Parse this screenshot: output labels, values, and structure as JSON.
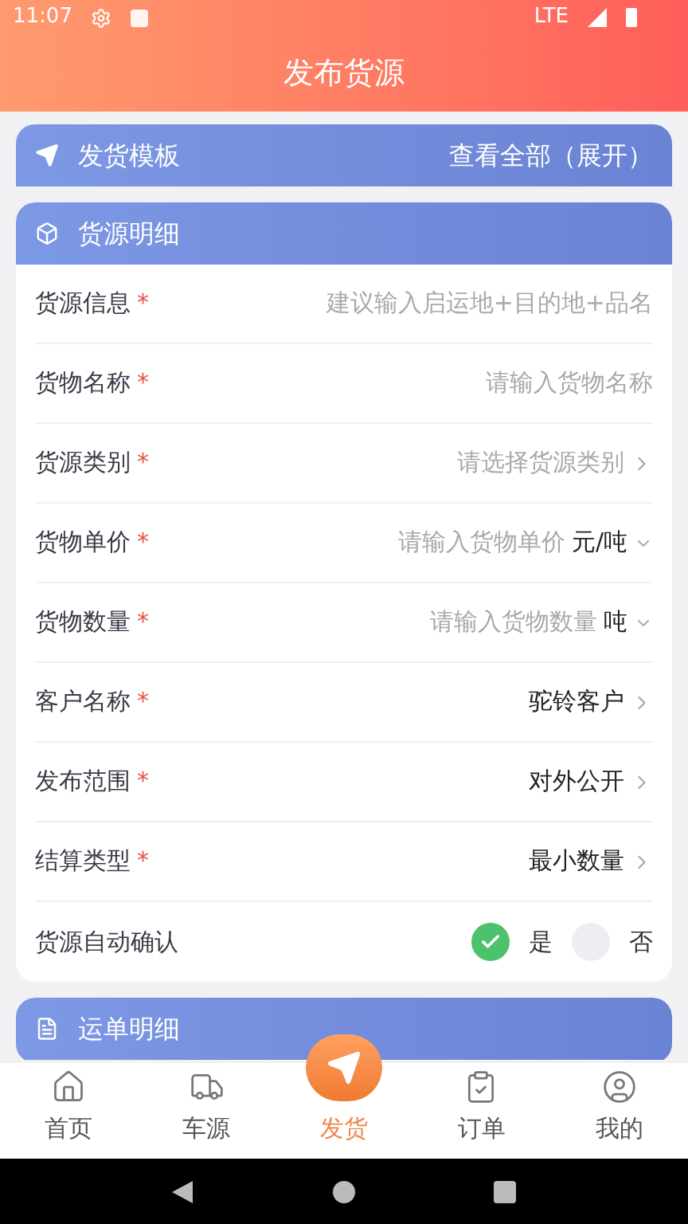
{
  "status_bar": {
    "time": "11:07",
    "network": "LTE"
  },
  "header": {
    "title": "发布货源"
  },
  "template_bar": {
    "title": "发货模板",
    "link": "查看全部（展开）"
  },
  "cargo_section": {
    "title": "货源明细",
    "rows": [
      {
        "label": "货源信息",
        "required_mark": "*",
        "kind": "input",
        "placeholder": "建议输入启运地+目的地+品名"
      },
      {
        "label": "货物名称",
        "required_mark": "*",
        "kind": "input",
        "placeholder": "请输入货物名称"
      },
      {
        "label": "货源类别",
        "required_mark": "*",
        "kind": "select",
        "placeholder": "请选择货源类别"
      },
      {
        "label": "货物单价",
        "required_mark": "*",
        "kind": "unit",
        "placeholder": "请输入货物单价",
        "unit": "元/吨"
      },
      {
        "label": "货物数量",
        "required_mark": "*",
        "kind": "unit",
        "placeholder": "请输入货物数量",
        "unit": "吨"
      },
      {
        "label": "客户名称",
        "required_mark": "*",
        "kind": "select",
        "value": "驼铃客户"
      },
      {
        "label": "发布范围",
        "required_mark": "*",
        "kind": "select",
        "value": "对外公开"
      },
      {
        "label": "结算类型",
        "required_mark": "*",
        "kind": "select",
        "value": "最小数量"
      },
      {
        "label": "货源自动确认",
        "kind": "radio",
        "options": [
          {
            "label": "是",
            "selected": true
          },
          {
            "label": "否",
            "selected": false
          }
        ]
      }
    ]
  },
  "waybill_section": {
    "title": "运单明细"
  },
  "tab_bar": [
    {
      "label": "首页",
      "selected": false
    },
    {
      "label": "车源",
      "selected": false
    },
    {
      "label": "发货",
      "selected": true
    },
    {
      "label": "订单",
      "selected": false
    },
    {
      "label": "我的",
      "selected": false
    }
  ]
}
